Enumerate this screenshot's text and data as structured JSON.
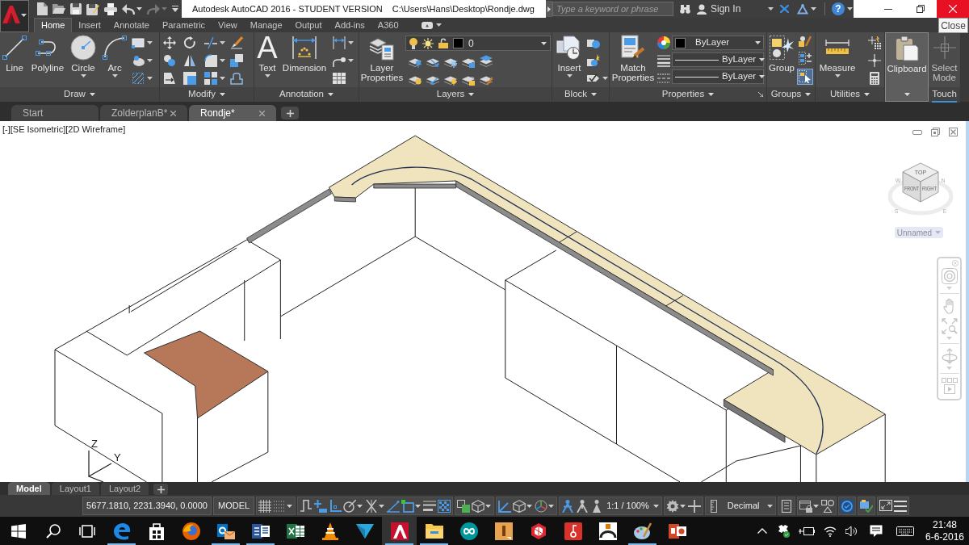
{
  "title_bar": {
    "quick_access": [
      {
        "kind": "new",
        "disabled": false
      },
      {
        "kind": "open",
        "disabled": false
      },
      {
        "kind": "save",
        "disabled": false
      },
      {
        "kind": "save_as",
        "disabled": false
      },
      {
        "kind": "print",
        "disabled": false
      },
      {
        "kind": "undo",
        "disabled": false,
        "dropdown": true
      },
      {
        "kind": "redo",
        "disabled": true,
        "dropdown": true
      },
      {
        "kind": "customize",
        "disabled": false
      }
    ],
    "title": "Autodesk AutoCAD 2016 - STUDENT VERSION",
    "file_path": "C:\\Users\\Hans\\Desktop\\Rondje.dwg",
    "search": {
      "placeholder": "Type a keyword or phrase"
    },
    "sign_in": "Sign In",
    "help": "?",
    "tooltip": "Close"
  },
  "ribbon_tabs": [
    {
      "label": "Home",
      "selected": true
    },
    {
      "label": "Insert",
      "selected": false
    },
    {
      "label": "Annotate",
      "selected": false
    },
    {
      "label": "Parametric",
      "selected": false
    },
    {
      "label": "View",
      "selected": false
    },
    {
      "label": "Manage",
      "selected": false
    },
    {
      "label": "Output",
      "selected": false
    },
    {
      "label": "Add-ins",
      "selected": false
    },
    {
      "label": "A360",
      "selected": false
    }
  ],
  "ribbon_panels": [
    {
      "kind": "draw",
      "title": "Draw",
      "expandable": true,
      "highlighted": false,
      "buttons": [
        {
          "label": "Line",
          "dropdown": false
        },
        {
          "label": "Polyline",
          "dropdown": false
        },
        {
          "label": "Circle",
          "dropdown": true
        },
        {
          "label": "Arc",
          "dropdown": true
        }
      ]
    },
    {
      "kind": "modify",
      "title": "Modify",
      "expandable": true,
      "highlighted": false
    },
    {
      "kind": "annotation",
      "title": "Annotation",
      "expandable": true,
      "highlighted": false,
      "buttons": [
        {
          "label": "Text",
          "glyph": "A",
          "dropdown": true
        },
        {
          "label": "Dimension",
          "dropdown": false
        }
      ]
    },
    {
      "kind": "layers",
      "title": "Layers",
      "expandable": true,
      "highlighted": false,
      "buttons": [
        {
          "label": "Layer Properties",
          "dropdown": false
        }
      ],
      "current_layer": "0"
    },
    {
      "kind": "block",
      "title": "Block",
      "expandable": true,
      "highlighted": false,
      "buttons": [
        {
          "label": "Insert",
          "dropdown": true
        }
      ]
    },
    {
      "kind": "properties",
      "title": "Properties",
      "expandable": true,
      "highlighted": false,
      "buttons": [
        {
          "label": "Match Properties",
          "dropdown": false
        }
      ],
      "dropdowns": [
        "ByLayer",
        "ByLayer",
        "ByLayer"
      ]
    },
    {
      "kind": "groups",
      "title": "Groups",
      "expandable": true,
      "highlighted": false,
      "buttons": [
        {
          "label": "Group",
          "dropdown": false
        }
      ],
      "group_selection_on": true
    },
    {
      "kind": "utilities",
      "title": "Utilities",
      "expandable": true,
      "highlighted": false,
      "buttons": [
        {
          "label": "Measure",
          "dropdown": true
        }
      ]
    },
    {
      "kind": "clipboard",
      "expandable": true,
      "highlighted": true,
      "buttons": [
        {
          "label": "Clipboard",
          "dropdown": false
        }
      ]
    },
    {
      "kind": "touch",
      "title": "Touch",
      "expandable": false,
      "highlighted": false,
      "buttons": [
        {
          "label": "Select Mode",
          "dropdown": false
        }
      ]
    }
  ],
  "file_tabs": [
    {
      "label": "Start",
      "selected": false,
      "closable": false
    },
    {
      "label": "ZolderplanB*",
      "selected": false,
      "closable": true
    },
    {
      "label": "Rondje*",
      "selected": true,
      "closable": true
    }
  ],
  "viewport": {
    "controls": [
      "[-]",
      "[SE Isometric]",
      "[2D Wireframe]"
    ],
    "viewcube": {
      "faces": [
        "TOP",
        "FRONT",
        "RIGHT"
      ],
      "compass": [
        "W",
        "N",
        "S",
        "E"
      ],
      "ucs_name": "Unnamed"
    },
    "ucs_axes": [
      "Z",
      "Y"
    ]
  },
  "layout_tabs": [
    {
      "label": "Model",
      "selected": true
    },
    {
      "label": "Layout1",
      "selected": false
    },
    {
      "label": "Layout2",
      "selected": false
    }
  ],
  "status_bar": {
    "coordinates": "5677.1810, 2231.3940, 0.0000",
    "space": "MODEL",
    "groups": [
      [
        {
          "kind": "grid",
          "on": false
        },
        {
          "kind": "snap",
          "on": false,
          "dropdown": true
        }
      ],
      [
        {
          "kind": "infer",
          "on": false
        },
        {
          "kind": "dynamic_input",
          "on": true
        },
        {
          "kind": "ortho",
          "on": true
        },
        {
          "kind": "polar",
          "on": false,
          "dropdown": true
        },
        {
          "kind": "isodraft",
          "on": false,
          "dropdown": true
        },
        {
          "kind": "object_track",
          "on": true
        },
        {
          "kind": "object_snap",
          "on": true,
          "dropdown": true
        },
        {
          "kind": "lineweight",
          "on": false
        },
        {
          "kind": "transparency",
          "on": true
        }
      ],
      [
        {
          "kind": "selection_cycling",
          "on": false
        },
        {
          "kind": "snap_3d",
          "on": false,
          "dropdown": true
        }
      ],
      [
        {
          "kind": "dynamic_ucs",
          "on": true
        },
        {
          "kind": "selection_filter",
          "on": false,
          "dropdown": true
        },
        {
          "kind": "gizmo",
          "dropdown": true
        }
      ],
      [
        {
          "kind": "annotation_visibility",
          "on": true
        },
        {
          "kind": "auto_scale",
          "on": false
        },
        {
          "kind": "annotation_scale",
          "on": false
        },
        {
          "kind": "scale",
          "label": "1:1 / 100%",
          "dropdown": true
        }
      ],
      [
        {
          "kind": "workspace",
          "dropdown": true
        },
        {
          "kind": "annotation_monitor",
          "on": false
        }
      ],
      [
        {
          "kind": "units",
          "label": "Decimal",
          "dropdown": true
        }
      ],
      [
        {
          "kind": "quick_properties",
          "on": false
        }
      ],
      [
        {
          "kind": "lock_ui",
          "dropdown": true
        },
        {
          "kind": "isolate",
          "on": false
        }
      ],
      [
        {
          "kind": "hardware_acceleration",
          "on": true
        }
      ],
      [
        {
          "kind": "clean_screen"
        }
      ],
      [
        {
          "kind": "full_screen"
        },
        {
          "kind": "customize"
        }
      ]
    ]
  },
  "taskbar": {
    "apps": [
      {
        "kind": "e_browser",
        "running": true,
        "active": false
      },
      {
        "kind": "bag",
        "running": false,
        "active": false
      },
      {
        "kind": "globe",
        "running": false,
        "active": false
      },
      {
        "kind": "mail",
        "running": true,
        "active": false
      },
      {
        "kind": "document",
        "running": true,
        "active": false
      },
      {
        "kind": "spreadsheet",
        "running": false,
        "active": false
      },
      {
        "kind": "cone",
        "running": false,
        "active": false
      },
      {
        "kind": "triangle",
        "running": false,
        "active": false
      },
      {
        "kind": "cad",
        "running": true,
        "active": true
      },
      {
        "kind": "folder",
        "running": true,
        "active": false
      },
      {
        "kind": "infinity",
        "running": false,
        "active": false
      },
      {
        "kind": "bar_tile",
        "running": false,
        "active": false
      },
      {
        "kind": "hexagon",
        "running": false,
        "active": false
      },
      {
        "kind": "curl_tile",
        "running": false,
        "active": false
      },
      {
        "kind": "arch_tile",
        "running": false,
        "active": false
      },
      {
        "kind": "palette",
        "running": true,
        "active": false
      },
      {
        "kind": "slides",
        "running": false,
        "active": false
      }
    ],
    "time": "21:48",
    "date": "6-6-2016"
  }
}
